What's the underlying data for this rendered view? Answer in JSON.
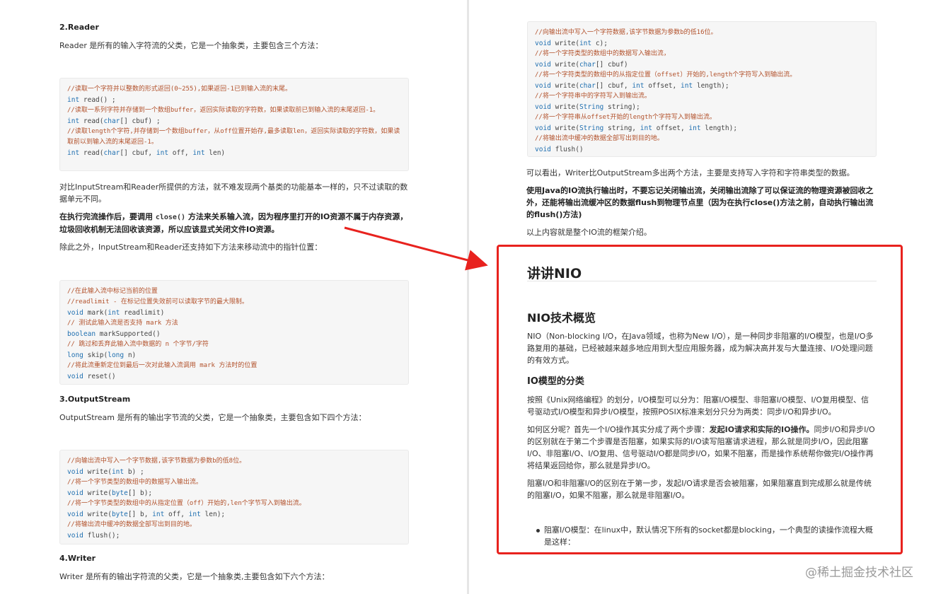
{
  "left": {
    "reader_heading": "2.Reader",
    "reader_intro": "Reader 是所有的输入字符流的父类，它是一个抽象类，主要包含三个方法：",
    "reader_code": [
      {
        "t": "//读取一个字符并以整数的形式返回(0~255),如果返回-1已到输入流的末尾。",
        "c": true
      },
      {
        "t": "int read() ;",
        "c": false
      },
      {
        "t": "//读取一系列字符并存储到一个数组buffer，返回实际读取的字符数，如果读取前已到输入流的末尾返回-1。",
        "c": true
      },
      {
        "t": "int read(char[] cbuf) ;",
        "c": false
      },
      {
        "t": "//读取length个字符,并存储到一个数组buffer，从off位置开始存,最多读取len，返回实际读取的字符数，如果读取前以到输入流的末尾返回-1。",
        "c": true
      },
      {
        "t": "int read(char[] cbuf, int off, int len)",
        "c": false
      }
    ],
    "compare_para": "对比InputStream和Reader所提供的方法，就不难发现两个基类的功能基本一样的，只不过读取的数据单元不同。",
    "close_para_1": "在执行完流操作后，要调用 ",
    "close_code": "close()",
    "close_para_2": " 方法来关系输入流，因为程序里打开的IO资源不属于内存资源，垃圾回收机制无法回收该资源，所以应该显式关闭文件IO资源。",
    "pointer_para": "除此之外，InputStream和Reader还支持如下方法来移动流中的指针位置：",
    "mark_code": [
      {
        "t": "//在此输入流中标记当前的位置",
        "c": true
      },
      {
        "t": "//readlimit - 在标记位置失效前可以读取字节的最大限制。",
        "c": true
      },
      {
        "t": "void mark(int readlimit)",
        "c": false
      },
      {
        "t": "// 测试此输入流是否支持 mark 方法",
        "c": true
      },
      {
        "t": "boolean markSupported()",
        "c": false
      },
      {
        "t": "// 跳过和丢弃此输入流中数据的 n 个字节/字符",
        "c": true
      },
      {
        "t": "long skip(long n)",
        "c": false
      },
      {
        "t": "//将此流重新定位到最后一次对此输入流调用 mark 方法时的位置",
        "c": true
      },
      {
        "t": "void reset()",
        "c": false
      }
    ],
    "output_heading": "3.OutputStream",
    "output_intro": "OutputStream 是所有的输出字节流的父类，它是一个抽象类，主要包含如下四个方法：",
    "output_code": [
      {
        "t": "//向输出流中写入一个字节数据,该字节数据为参数b的低8位。",
        "c": true
      },
      {
        "t": "void write(int b) ;",
        "c": false
      },
      {
        "t": "//将一个字节类型的数组中的数据写入输出流。",
        "c": true
      },
      {
        "t": "void write(byte[] b);",
        "c": false
      },
      {
        "t": "//将一个字节类型的数组中的从指定位置（off）开始的,len个字节写入到输出流。",
        "c": true
      },
      {
        "t": "void write(byte[] b, int off, int len);",
        "c": false
      },
      {
        "t": "//将输出流中缓冲的数据全部写出到目的地。",
        "c": true
      },
      {
        "t": "void flush();",
        "c": false
      }
    ],
    "writer_heading": "4.Writer",
    "writer_intro": "Writer 是所有的输出字符流的父类，它是一个抽象类,主要包含如下六个方法："
  },
  "right": {
    "writer_code": [
      {
        "t": "//向输出流中写入一个字符数据,该字节数据为参数b的低16位。",
        "c": true
      },
      {
        "t": "void write(int c);",
        "c": false
      },
      {
        "t": "//将一个字符类型的数组中的数据写入输出流，",
        "c": true
      },
      {
        "t": "void write(char[] cbuf)",
        "c": false
      },
      {
        "t": "//将一个字符类型的数组中的从指定位置（offset）开始的,length个字符写入到输出流。",
        "c": true
      },
      {
        "t": "void write(char[] cbuf, int offset, int length);",
        "c": false
      },
      {
        "t": "//将一个字符串中的字符写入到输出流。",
        "c": true
      },
      {
        "t": "void write(String string);",
        "c": false
      },
      {
        "t": "//将一个字符串从offset开始的length个字符写入到输出流。",
        "c": true
      },
      {
        "t": "void write(String string, int offset, int length);",
        "c": false
      },
      {
        "t": "//将输出流中缓冲的数据全部写出到目的地。",
        "c": true
      },
      {
        "t": "void flush()",
        "c": false
      }
    ],
    "writer_note": "可以看出，Writer比OutputStream多出两个方法，主要是支持写入字符和字符串类型的数据。",
    "bold_para": "使用Java的IO流执行输出时，不要忘记关闭输出流，关闭输出流除了可以保证流的物理资源被回收之外，还能将输出流缓冲区的数据flush到物理节点里（因为在执行close()方法之前，自动执行输出流的flush()方法)",
    "summary": "以上内容就是整个IO流的框架介绍。",
    "nio_title": "讲讲NIO",
    "nio_overview_heading": "NIO技术概览",
    "nio_overview_para": "NIO（Non-blocking I/O，在Java领域，也称为New I/O），是一种同步非阻塞的I/O模型，也是I/O多路复用的基础，已经被越来越多地应用到大型应用服务器，成为解决高并发与大量连接、I/O处理问题的有效方式。",
    "io_model_heading": "IO模型的分类",
    "io_model_para": "按照《Unix网络编程》的划分，I/O模型可以分为：阻塞I/O模型、非阻塞I/O模型、I/O复用模型、信号驱动式I/O模型和异步I/O模型，按照POSIX标准来划分只分为两类：同步I/O和异步I/O。",
    "distinguish_1": "如何区分呢？首先一个I/O操作其实分成了两个步骤：",
    "distinguish_bold": "发起IO请求和实际的IO操作。",
    "distinguish_2": "同步I/O和异步I/O的区别就在于第二个步骤是否阻塞，如果实际的I/O读写阻塞请求进程，那么就是同步I/O，因此阻塞I/O、非阻塞I/O、I/O复用、信号驱动I/O都是同步I/O，如果不阻塞，而是操作系统帮你做完I/O操作再将结果返回给你，那么就是异步I/O。",
    "blocking_para": "阻塞I/O和非阻塞I/O的区别在于第一步，发起I/O请求是否会被阻塞，如果阻塞直到完成那么就是传统的阻塞I/O，如果不阻塞，那么就是非阻塞I/O。",
    "bullet_text": "阻塞I/O模型：在linux中，默认情况下所有的socket都是blocking，一个典型的读操作流程大概是这样："
  },
  "watermark": "@稀土掘金技术社区",
  "colors": {
    "highlight": "#e8221e",
    "code_keyword": "#1f6fb0",
    "code_comment": "#b2512b"
  }
}
